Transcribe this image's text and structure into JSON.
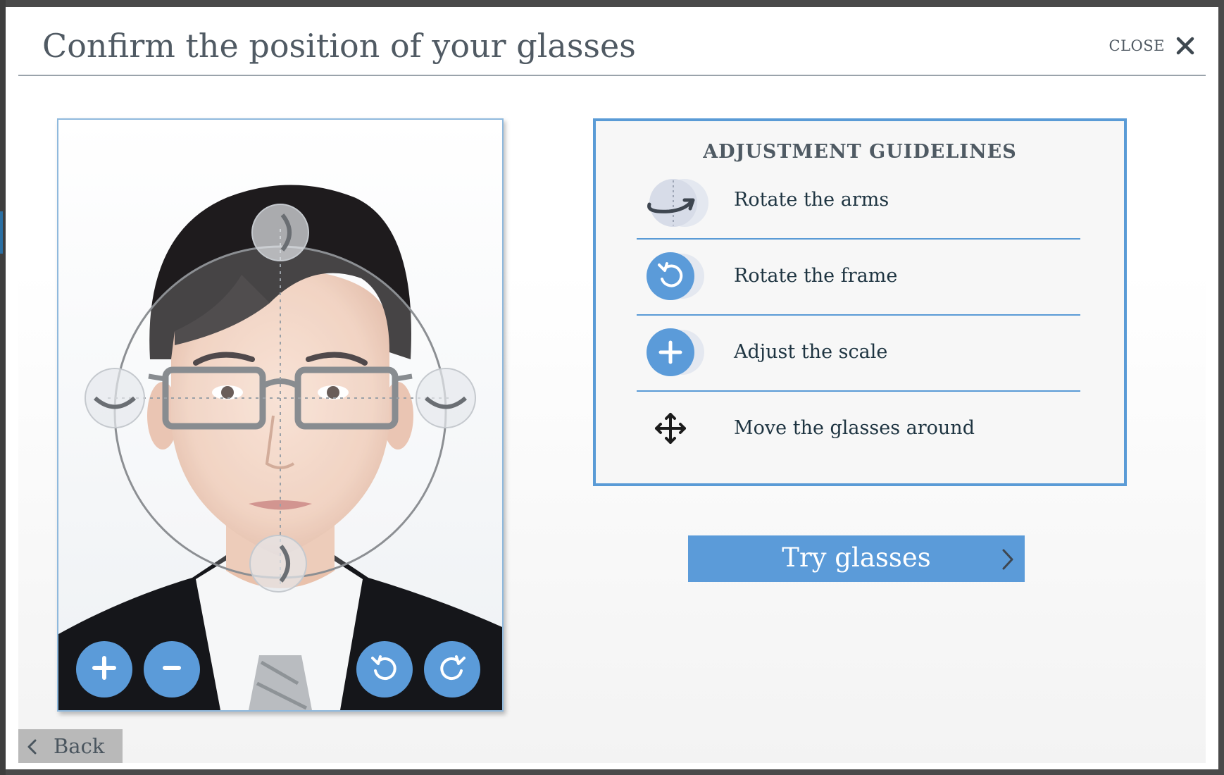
{
  "dialog": {
    "title": "Confirm the position of your glasses",
    "close_label": "CLOSE"
  },
  "controls": {
    "zoom_in_icon": "plus-icon",
    "zoom_out_icon": "minus-icon",
    "rotate_left_icon": "rotate-left-icon",
    "rotate_right_icon": "rotate-right-icon"
  },
  "guidelines": {
    "title": "ADJUSTMENT GUIDELINES",
    "items": [
      {
        "label": "Rotate the arms",
        "icon": "rotate-arms-icon"
      },
      {
        "label": "Rotate the frame",
        "icon": "rotate-frame-icon"
      },
      {
        "label": "Adjust the scale",
        "icon": "scale-plus-icon"
      },
      {
        "label": "Move the glasses around",
        "icon": "move-icon"
      }
    ]
  },
  "actions": {
    "try_label": "Try glasses",
    "back_label": "Back"
  },
  "colors": {
    "accent": "#5b9bd9",
    "border": "#5a9bd6",
    "title_text": "#505a63",
    "back_button": "#b9b9b9"
  }
}
